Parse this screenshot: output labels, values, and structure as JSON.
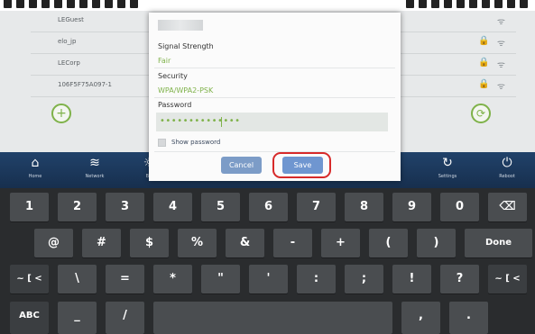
{
  "networks": [
    {
      "ssid": "LEGuest",
      "locked": false
    },
    {
      "ssid": "elo_jp",
      "locked": true
    },
    {
      "ssid": "LECorp",
      "locked": true
    },
    {
      "ssid": "106F5F75A097-1",
      "locked": true
    }
  ],
  "buttons": {
    "add": "+",
    "refresh": "⟳"
  },
  "nav": {
    "home": "Home",
    "network": "Network",
    "brightness": "Bri",
    "settings": "Settings",
    "reboot": "Reboot"
  },
  "dialog": {
    "signal_label": "Signal Strength",
    "signal_value": "Fair",
    "security_label": "Security",
    "security_value": "WPA/WPA2-PSK",
    "password_label": "Password",
    "password_value": "••••••••••••••",
    "show_password": "Show password",
    "show_password_checked": false,
    "cancel": "Cancel",
    "save": "Save"
  },
  "keyboard": {
    "row1": [
      "1",
      "2",
      "3",
      "4",
      "5",
      "6",
      "7",
      "8",
      "9",
      "0",
      "⌫"
    ],
    "row2": [
      "@",
      "#",
      "$",
      "%",
      "&",
      "-",
      "+",
      "(",
      ")",
      "Done"
    ],
    "row3": [
      "~ [ <",
      "\\",
      "=",
      "*",
      "\"",
      "'",
      ":",
      ";",
      "!",
      "?",
      "~ [ <"
    ],
    "row4": [
      "ABC",
      "_",
      "/",
      " ",
      ",",
      "."
    ]
  },
  "colors": {
    "accent_green": "#7fb24a",
    "nav_blue": "#1d3a5f",
    "highlight_red": "#d72a2a"
  }
}
